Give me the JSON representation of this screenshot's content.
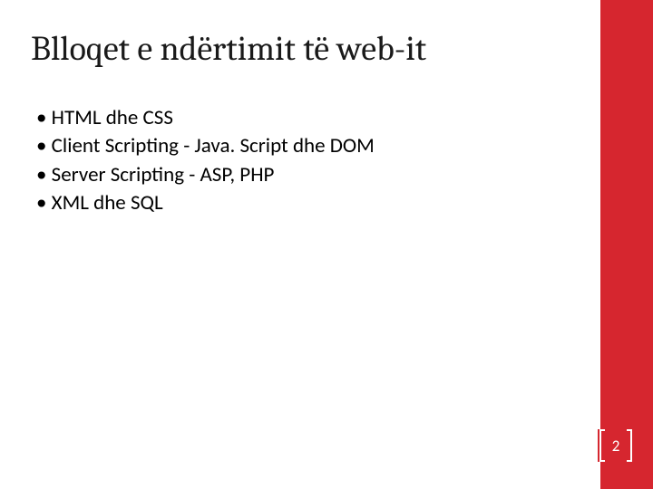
{
  "slide": {
    "title": "Blloqet e ndërtimit të web-it",
    "bullets": [
      "HTML dhe CSS",
      "Client Scripting - Java. Script dhe DOM",
      "Server Scripting - ASP, PHP",
      "XML dhe SQL"
    ],
    "page_number": "2"
  },
  "theme": {
    "accent": "#d6262f",
    "text": "#000000",
    "title_color": "#1a1a1a"
  }
}
